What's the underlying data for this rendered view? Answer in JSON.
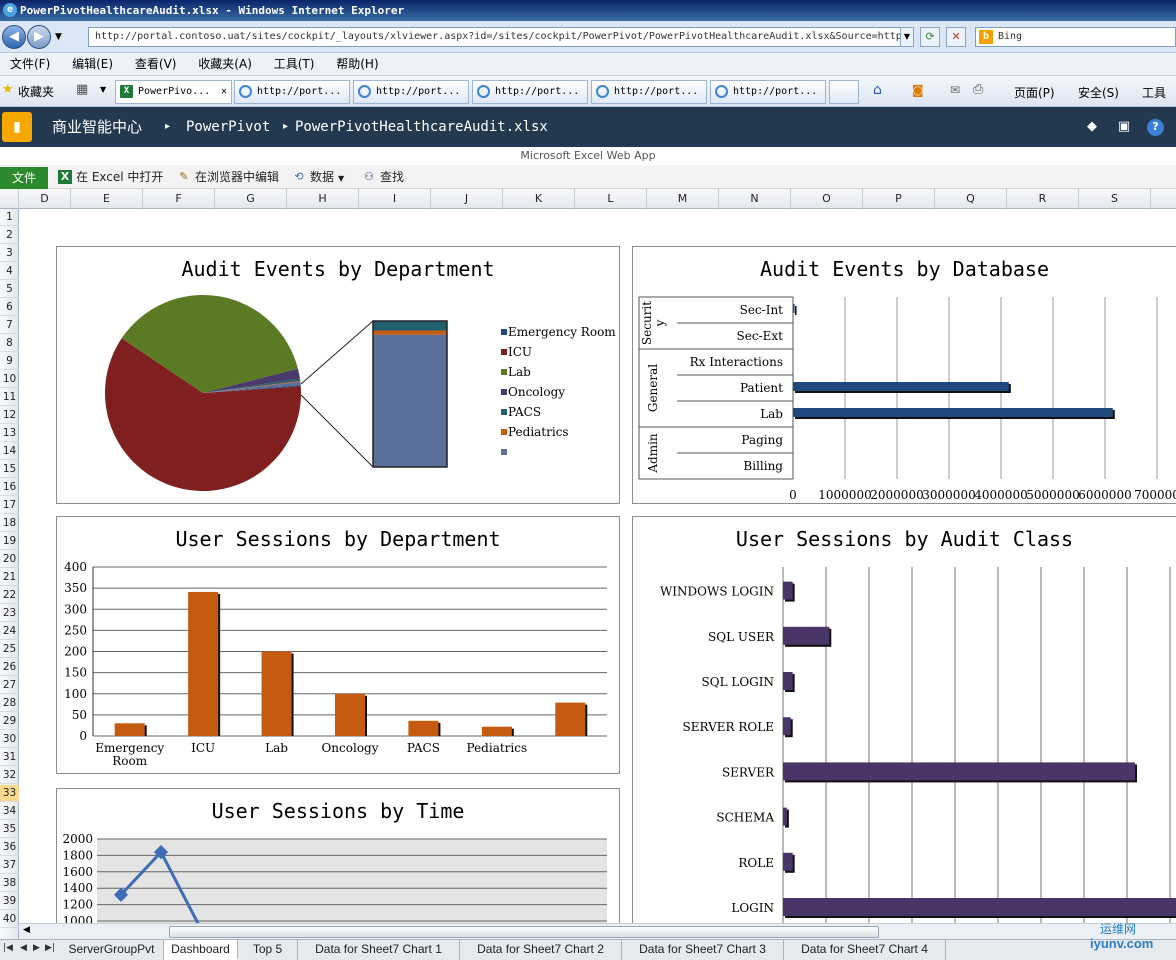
{
  "window": {
    "title": "PowerPivotHealthcareAudit.xlsx - Windows Internet Explorer"
  },
  "browser": {
    "url": "http://portal.contoso.uat/sites/cockpit/_layouts/xlviewer.aspx?id=/sites/cockpit/PowerPivot/PowerPivotHealthcareAudit.xlsx&Source=http",
    "search_placeholder": "Bing",
    "menus": [
      "文件(F)",
      "编辑(E)",
      "查看(V)",
      "收藏夹(A)",
      "工具(T)",
      "帮助(H)"
    ],
    "favorites_label": "收藏夹",
    "tabs": [
      "PowerPivo...",
      "http://port...",
      "http://port...",
      "http://port...",
      "http://port...",
      "http://port..."
    ],
    "cmd_page": "页面(P)",
    "cmd_safety": "安全(S)",
    "cmd_tools": "工具"
  },
  "sharepoint": {
    "site": "商业智能中心",
    "crumb1": "PowerPivot",
    "crumb2": "PowerPivotHealthcareAudit.xlsx",
    "webapp_label": "Microsoft Excel Web App"
  },
  "ribbon": {
    "file": "文件",
    "open_excel": "在 Excel 中打开",
    "edit_browser": "在浏览器中编辑",
    "data": "数据",
    "find": "查找"
  },
  "columns": [
    "D",
    "E",
    "F",
    "G",
    "H",
    "I",
    "J",
    "K",
    "L",
    "M",
    "N",
    "O",
    "P",
    "Q",
    "R",
    "S"
  ],
  "rows": [
    "1",
    "2",
    "3",
    "4",
    "5",
    "6",
    "7",
    "8",
    "9",
    "10",
    "11",
    "12",
    "13",
    "14",
    "15",
    "16",
    "17",
    "18",
    "19",
    "20",
    "21",
    "22",
    "23",
    "24",
    "25",
    "26",
    "27",
    "28",
    "29",
    "30",
    "31",
    "32",
    "33",
    "34",
    "35",
    "36",
    "37",
    "38",
    "39",
    "40"
  ],
  "selected_row": "33",
  "chart_data": [
    {
      "type": "pie",
      "title": "Audit Events by Department",
      "legend": [
        "Emergency Room",
        "ICU",
        "Lab",
        "Oncology",
        "PACS",
        "Pediatrics",
        ""
      ],
      "colors": [
        "#1f497d",
        "#7f1f1f",
        "#5a7a23",
        "#4a3a6b",
        "#215e6e",
        "#c55a11",
        "#5b6f9b"
      ],
      "values": [
        0.2,
        60.5,
        36.6,
        1.6,
        0.4,
        0.15,
        0.55
      ],
      "breakout": {
        "values": [
          6.5,
          3,
          90.5
        ],
        "colors": [
          "#215e6e",
          "#c55a11",
          "#5b6f9b"
        ]
      }
    },
    {
      "type": "bar",
      "title": "Audit Events by Database",
      "groups": [
        {
          "name": "Security",
          "display": [
            "Securit",
            "y"
          ],
          "items": [
            {
              "label": "Sec-Int",
              "value": 30000
            },
            {
              "label": "Sec-Ext",
              "value": 0
            }
          ]
        },
        {
          "name": "General",
          "display": [
            "General"
          ],
          "items": [
            {
              "label": "Rx Interactions",
              "value": 0
            },
            {
              "label": "Patient",
              "value": 4150000
            },
            {
              "label": "Lab",
              "value": 6150000
            }
          ]
        },
        {
          "name": "Admin",
          "display": [
            "Admin"
          ],
          "items": [
            {
              "label": "Paging",
              "value": 0
            },
            {
              "label": "Billing",
              "value": 0
            }
          ]
        }
      ],
      "xticks": [
        "0",
        "1000000",
        "2000000",
        "3000000",
        "4000000",
        "5000000",
        "6000000",
        "700000"
      ],
      "xlim": [
        0,
        7000000
      ],
      "color": "#1f497d"
    },
    {
      "type": "bar",
      "title": "User Sessions by Department",
      "categories": [
        [
          "Emergency",
          "Room"
        ],
        [
          "ICU"
        ],
        [
          "Lab"
        ],
        [
          "Oncology"
        ],
        [
          "PACS"
        ],
        [
          "Pediatrics"
        ],
        [
          ""
        ]
      ],
      "values": [
        30,
        341,
        200,
        100,
        36,
        22,
        79
      ],
      "ylim": [
        0,
        400
      ],
      "yticks": [
        "0",
        "50",
        "100",
        "150",
        "200",
        "250",
        "300",
        "350",
        "400"
      ],
      "color": "#c55a11"
    },
    {
      "type": "bar",
      "title": "User Sessions by Audit Class",
      "categories": [
        "WINDOWS LOGIN",
        "SQL USER",
        "SQL LOGIN",
        "SERVER ROLE",
        "SERVER",
        "SCHEMA",
        "ROLE",
        "LOGIN"
      ],
      "values": [
        10,
        48,
        10,
        8,
        365,
        4,
        10,
        408
      ],
      "xlim": [
        0,
        450
      ],
      "color": "#4a3568"
    },
    {
      "type": "line",
      "title": "User Sessions by Time",
      "y": [
        1320,
        1840,
        900
      ],
      "ylim": [
        1000,
        2000
      ],
      "yticks": [
        "1000",
        "1200",
        "1400",
        "1600",
        "1800",
        "2000"
      ],
      "color": "#3e6db5"
    }
  ],
  "sheets": [
    "ServerGroupPvt",
    "Dashboard",
    "Top 5",
    "Data for Sheet7 Chart 1",
    "Data for Sheet7 Chart 2",
    "Data for Sheet7 Chart 3",
    "Data for Sheet7 Chart 4"
  ],
  "active_sheet": "Dashboard",
  "watermark": {
    "cn": "运维网",
    "en": "iyunv.com"
  }
}
